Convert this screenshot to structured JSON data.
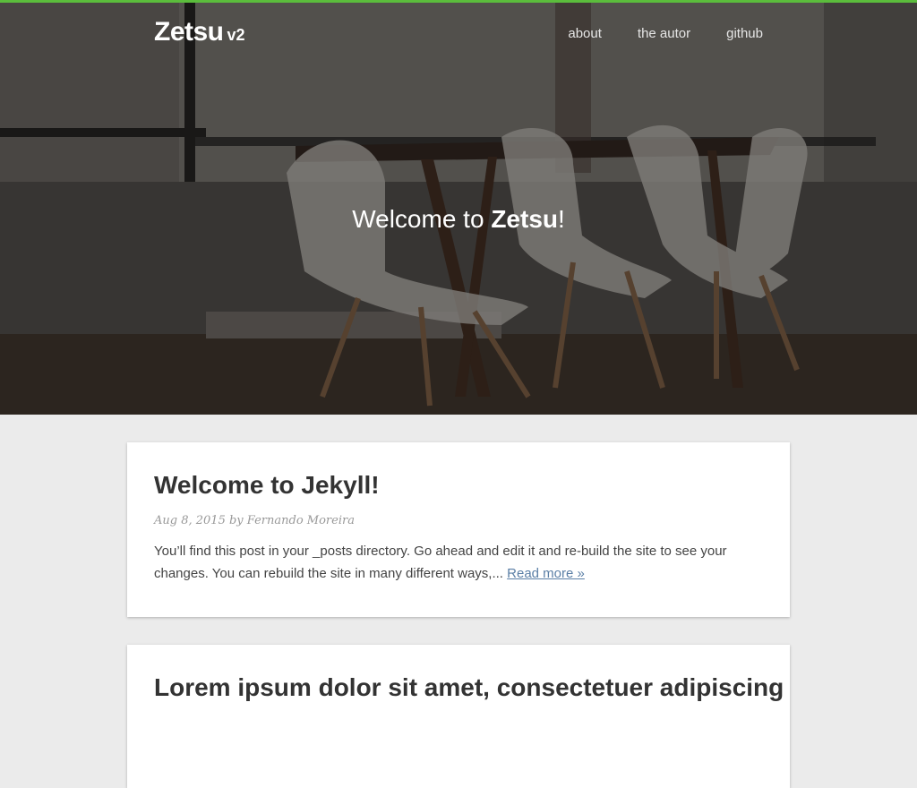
{
  "header": {
    "brand_name": "Zetsu",
    "brand_version": "v2",
    "nav": [
      {
        "label": "about"
      },
      {
        "label": "the autor"
      },
      {
        "label": "github"
      }
    ],
    "accent_color": "#5bbd3c"
  },
  "hero": {
    "title_prefix": "Welcome to ",
    "title_strong": "Zetsu",
    "title_suffix": "!"
  },
  "posts": [
    {
      "title": "Welcome to Jekyll!",
      "date": "Aug 8, 2015",
      "by": "by",
      "author": "Fernando Moreira",
      "excerpt": "You’ll find this post in your _posts directory. Go ahead and edit it and re-build the site to see your changes. You can rebuild the site in many different ways,...",
      "read_more": "Read more »"
    },
    {
      "title": "Lorem ipsum dolor sit amet, consectetuer adipiscing"
    }
  ],
  "colors": {
    "link": "#5b7fa6",
    "page_background": "#ebebeb"
  }
}
